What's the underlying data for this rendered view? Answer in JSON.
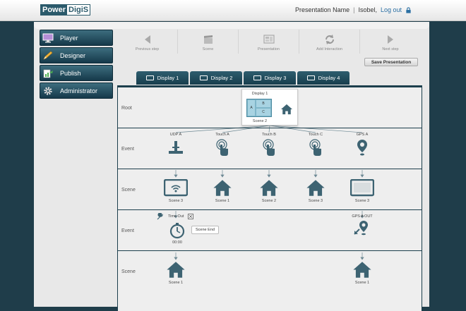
{
  "logo": {
    "part1": "Power",
    "part2": "DigiS"
  },
  "user": {
    "presentation_name": "Presentation Name",
    "separator": "|",
    "username": "Isobel,",
    "logout": "Log out"
  },
  "sidebar": {
    "items": [
      {
        "label": "Player",
        "icon": "monitor-icon"
      },
      {
        "label": "Designer",
        "icon": "pencil-icon"
      },
      {
        "label": "Publish",
        "icon": "publish-icon"
      },
      {
        "label": "Administrator",
        "icon": "gear-icon"
      }
    ]
  },
  "toolbar": {
    "prev": "Previous step",
    "scene": "Scene",
    "presentation": "Presentation",
    "add_interaction": "Add Interaction",
    "next": "Next step",
    "save": "Save Presentation"
  },
  "tabs": [
    "Display 1",
    "Display 2",
    "Display 3",
    "Display 4"
  ],
  "rows": {
    "root": "Root",
    "event1": "Event",
    "scene1": "Scene",
    "event2": "Event",
    "scene2": "Scene"
  },
  "root_node": {
    "title": "Display 1",
    "zone_a": "A",
    "zone_b": "B",
    "zone_c": "C",
    "scene": "Scene 2"
  },
  "events": [
    {
      "label": "UDP A",
      "icon": "udp-icon"
    },
    {
      "label": "Touch A",
      "icon": "touch-icon"
    },
    {
      "label": "Touch B",
      "icon": "touch-icon"
    },
    {
      "label": "Touch C",
      "icon": "touch-icon"
    },
    {
      "label": "GPS A",
      "icon": "gps-pin-icon"
    }
  ],
  "scenes": [
    {
      "label": "Scene 3",
      "icon": "wifi-screen-icon"
    },
    {
      "label": "Scene 1",
      "icon": "home-icon"
    },
    {
      "label": "Scene 2",
      "icon": "home-icon"
    },
    {
      "label": "Scene 3",
      "icon": "home-icon"
    },
    {
      "label": "Scene 3",
      "icon": "tablet-icon"
    }
  ],
  "timeout": {
    "label": "Time Out",
    "callout": "Scene End",
    "time": "00:00"
  },
  "gps_out": {
    "label": "GPS A OUT"
  },
  "final_scenes": [
    {
      "label": "Scene 1"
    },
    {
      "label": "Scene 1"
    }
  ],
  "colors": {
    "accent": "#2b5a6b",
    "icon": "#3d6372",
    "tab": "#1c3e4c"
  }
}
